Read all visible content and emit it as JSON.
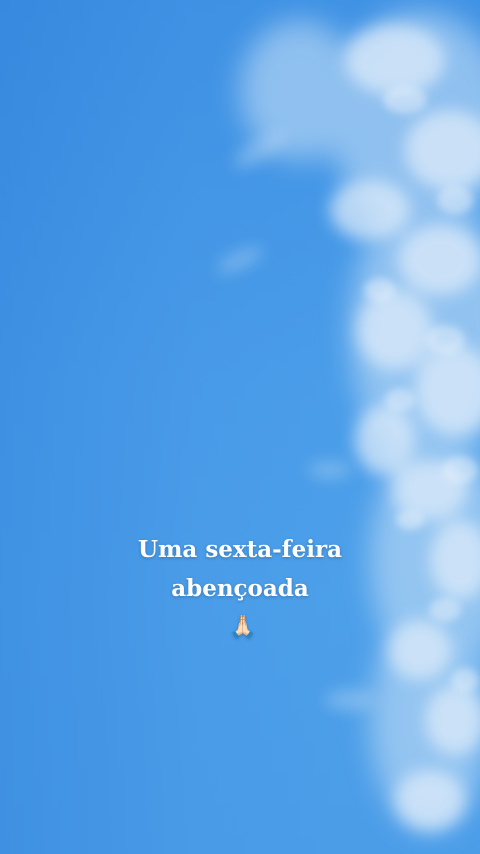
{
  "story": {
    "caption_line1": "Uma sexta-feira",
    "caption_line2": "abençoada",
    "emoji_icon": "praying-hands-icon",
    "emoji_glyph": "🙏🏻"
  },
  "colors": {
    "sky": "#4a9de8",
    "text": "#ffffff"
  }
}
